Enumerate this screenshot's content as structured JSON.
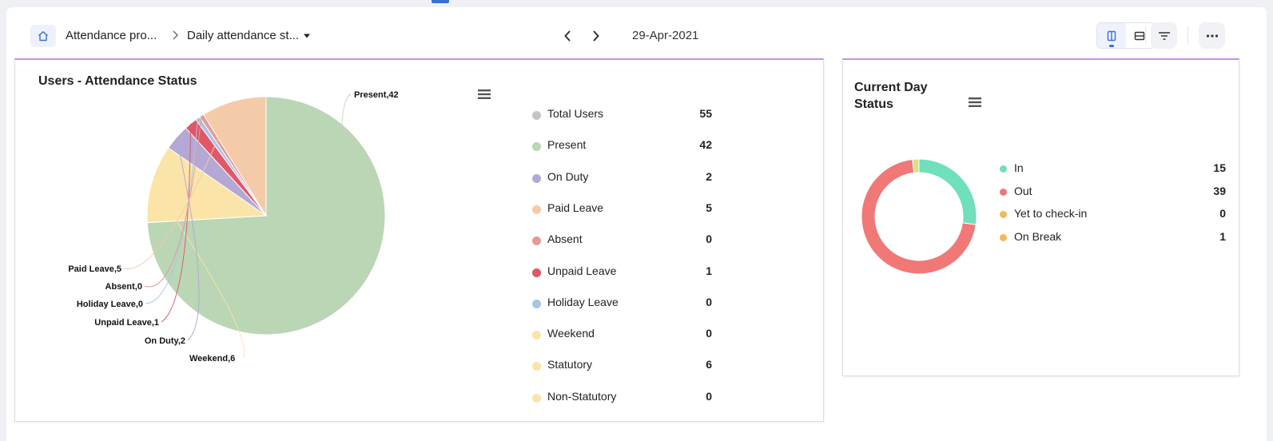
{
  "header": {
    "breadcrumb": [
      "Attendance pro...",
      "Daily attendance st..."
    ],
    "date": "29-Apr-2021"
  },
  "colors": {
    "accent": "#3b6fd6",
    "panel_border_top": "#c890e6"
  },
  "chart_data": [
    {
      "type": "pie",
      "title": "Users - Attendance Status",
      "slices": [
        {
          "name": "Present",
          "value": 42,
          "color": "#bad6b4",
          "label": "Present,42"
        },
        {
          "name": "Weekend",
          "value": 6,
          "color": "#fbe4a8",
          "label": "Weekend,6"
        },
        {
          "name": "On Duty",
          "value": 2,
          "color": "#b4a8d4",
          "label": "On Duty,2"
        },
        {
          "name": "Unpaid Leave",
          "value": 1,
          "color": "#df5868",
          "label": "Unpaid Leave,1"
        },
        {
          "name": "Holiday Leave",
          "value": 0,
          "color": "#a8c4e6",
          "label": "Holiday Leave,0"
        },
        {
          "name": "Absent",
          "value": 0,
          "color": "#e49a9a",
          "label": "Absent,0"
        },
        {
          "name": "Paid Leave",
          "value": 5,
          "color": "#f4caa8",
          "label": "Paid Leave,5"
        }
      ],
      "legend": [
        {
          "name": "Total Users",
          "value": 55,
          "color": "#c4c4c4"
        },
        {
          "name": "Present",
          "value": 42,
          "color": "#bad6b4"
        },
        {
          "name": "On Duty",
          "value": 2,
          "color": "#b4a8d4"
        },
        {
          "name": "Paid Leave",
          "value": 5,
          "color": "#f4caa8"
        },
        {
          "name": "Absent",
          "value": 0,
          "color": "#e49a9a"
        },
        {
          "name": "Unpaid Leave",
          "value": 1,
          "color": "#df5868"
        },
        {
          "name": "Holiday Leave",
          "value": 0,
          "color": "#a8c4e6"
        },
        {
          "name": "Weekend",
          "value": 0,
          "color": "#fbe4a8"
        },
        {
          "name": "Statutory",
          "value": 6,
          "color": "#fbe4a8"
        },
        {
          "name": "Non-Statutory",
          "value": 0,
          "color": "#fbe4a8"
        }
      ]
    },
    {
      "type": "pie",
      "title": "Current Day Status",
      "slices": [
        {
          "name": "In",
          "value": 15,
          "color": "#6fdfbe"
        },
        {
          "name": "Out",
          "value": 39,
          "color": "#f07876"
        },
        {
          "name": "Yet to check-in",
          "value": 0,
          "color": "#f4b95a"
        },
        {
          "name": "On Break",
          "value": 1,
          "color": "#d8e088"
        }
      ],
      "legend": [
        {
          "name": "In",
          "value": 15,
          "color": "#6fdfbe"
        },
        {
          "name": "Out",
          "value": 39,
          "color": "#f07876"
        },
        {
          "name": "Yet to check-in",
          "value": 0,
          "color": "#f4b95a"
        },
        {
          "name": "On Break",
          "value": 1,
          "color": "#f4b95a"
        }
      ]
    }
  ]
}
